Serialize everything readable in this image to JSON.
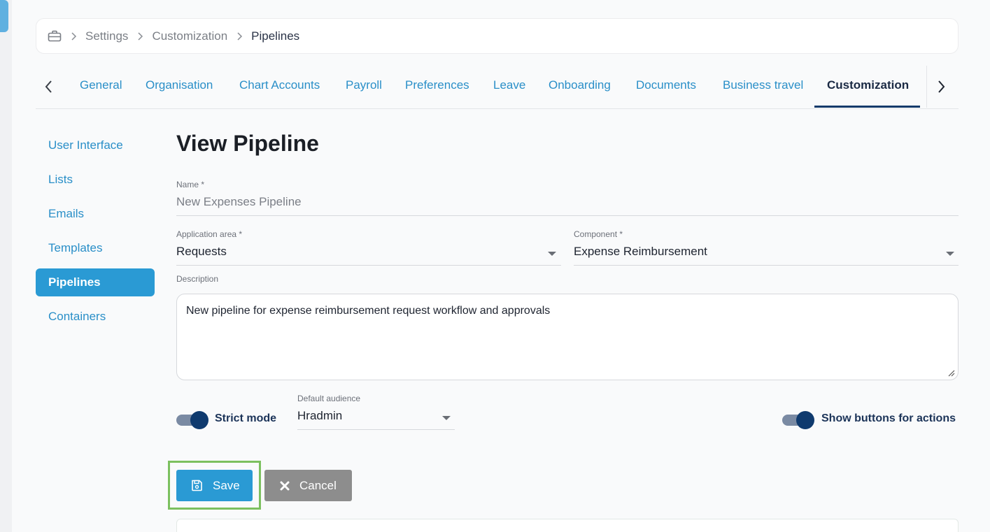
{
  "breadcrumb": {
    "items": [
      "Settings",
      "Customization",
      "Pipelines"
    ]
  },
  "tabs": [
    {
      "label": "General"
    },
    {
      "label": "Organisation"
    },
    {
      "label": "Chart Accounts"
    },
    {
      "label": "Payroll"
    },
    {
      "label": "Preferences"
    },
    {
      "label": "Leave"
    },
    {
      "label": "Onboarding"
    },
    {
      "label": "Documents"
    },
    {
      "label": "Business travel"
    },
    {
      "label": "Customization"
    }
  ],
  "active_tab": "Customization",
  "sidebar": {
    "items": [
      {
        "label": "User Interface"
      },
      {
        "label": "Lists"
      },
      {
        "label": "Emails"
      },
      {
        "label": "Templates"
      },
      {
        "label": "Pipelines"
      },
      {
        "label": "Containers"
      }
    ],
    "active": "Pipelines"
  },
  "page": {
    "title": "View Pipeline"
  },
  "form": {
    "name": {
      "label": "Name *",
      "value": "New Expenses Pipeline"
    },
    "application_area": {
      "label": "Application area *",
      "value": "Requests"
    },
    "component": {
      "label": "Component *",
      "value": "Expense Reimbursement"
    },
    "description": {
      "label": "Description",
      "value": "New pipeline for expense reimbursement request workflow and approvals"
    },
    "strict_mode": {
      "label": "Strict mode",
      "on": true
    },
    "default_audience": {
      "label": "Default audience",
      "value": "Hradmin"
    },
    "show_buttons": {
      "label": "Show buttons for actions",
      "on": true
    }
  },
  "actions": {
    "save_label": "Save",
    "cancel_label": "Cancel"
  },
  "colors": {
    "accent": "#2a9ad4",
    "link": "#2a8fc8",
    "toggle_knob": "#0f3a6e",
    "highlight": "#7cc05f",
    "cancel": "#8d8d8d"
  },
  "icons": {
    "home": "briefcase-icon",
    "save": "floppy-disk-icon",
    "cancel": "close-icon"
  }
}
